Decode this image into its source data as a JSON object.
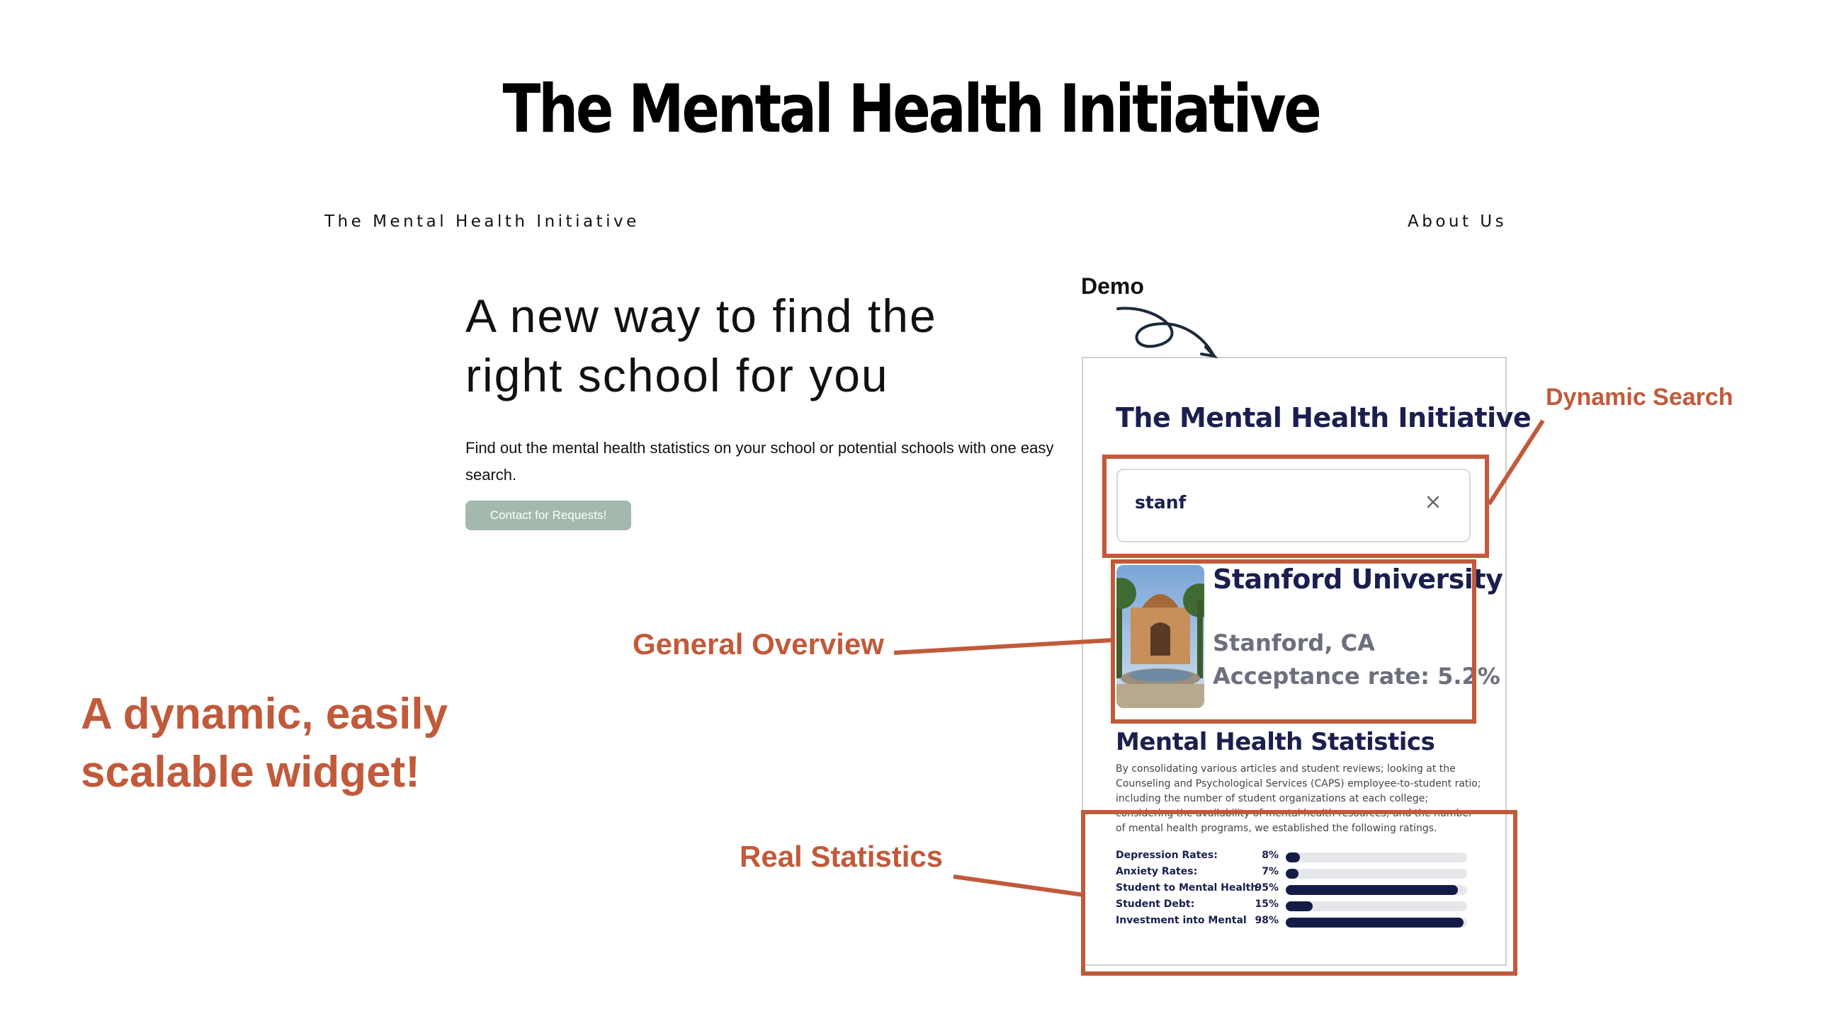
{
  "slide": {
    "title": "The Mental Health Initiative",
    "tagline": "A dynamic, easily scalable widget!",
    "demo_label": "Demo"
  },
  "site": {
    "brand": "The Mental Health Initiative",
    "nav_about": "About Us",
    "hero_heading": "A new way to find the right school for you",
    "hero_sub": "Find out the mental health statistics on your school or potential schools with one easy search.",
    "contact_button": "Contact for Requests!",
    "contact_button_color": "#a3b9ad"
  },
  "annotations": {
    "dynamic_search": "Dynamic Search",
    "general_overview": "General Overview",
    "real_statistics": "Real Statistics",
    "color": "#c15a3a"
  },
  "widget": {
    "title": "The Mental Health Initiative",
    "search_value": "stanf",
    "clear_icon": "close-icon",
    "university": {
      "name": "Stanford University",
      "location": "Stanford, CA",
      "acceptance": "Acceptance rate: 5.2%"
    },
    "stats_title": "Mental Health Statistics",
    "stats_description": "By consolidating various articles and student reviews; looking at the Counseling and Psychological Services (CAPS) employee-to-student ratio; including the number of student organizations at each college; considering the availability of mental health resources; and the number of mental health programs, we established the following ratings.",
    "stats": [
      {
        "label": "Depression Rates:",
        "percent": "8%",
        "value": 8
      },
      {
        "label": "Anxiety Rates:",
        "percent": "7%",
        "value": 7
      },
      {
        "label": "Student to Mental Health",
        "percent": "95%",
        "value": 95
      },
      {
        "label": "Student Debt:",
        "percent": "15%",
        "value": 15
      },
      {
        "label": "Investment into Mental",
        "percent": "98%",
        "value": 98
      }
    ],
    "bar_color": "#141b47"
  }
}
